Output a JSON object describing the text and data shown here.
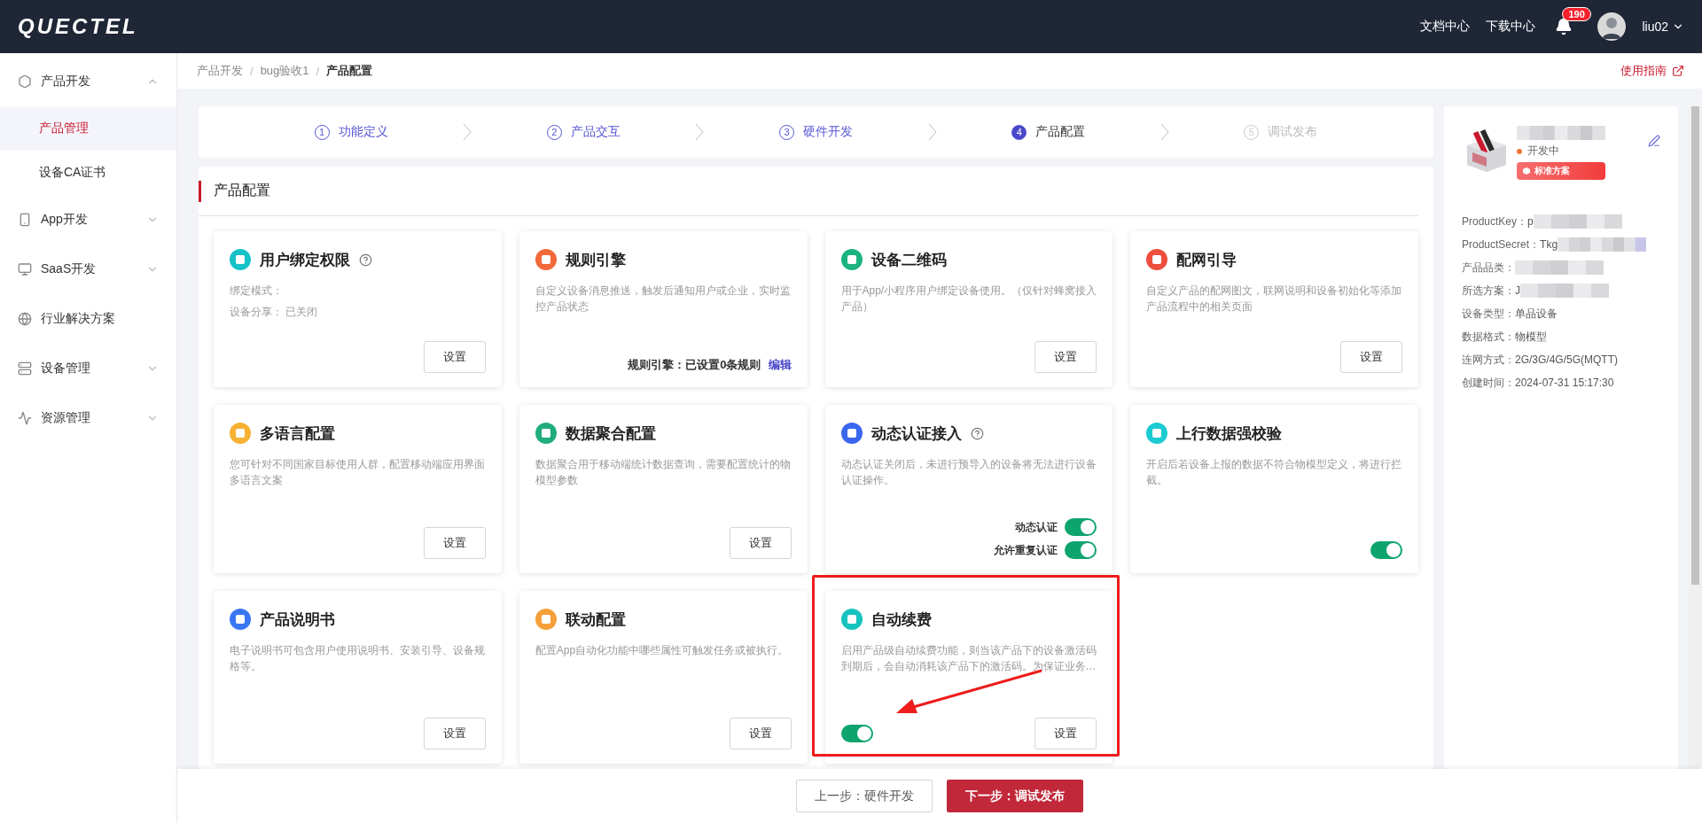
{
  "header": {
    "logo": "QUECTEL",
    "links": [
      "文档中心",
      "下载中心"
    ],
    "notifications": "190",
    "user": "liu02"
  },
  "sidebar": {
    "groups": [
      {
        "label": "产品开发",
        "expanded": true,
        "children": [
          {
            "label": "产品管理",
            "selected": true
          },
          {
            "label": "设备CA证书",
            "selected": false
          }
        ]
      },
      {
        "label": "App开发",
        "expanded": false
      },
      {
        "label": "SaaS开发",
        "expanded": false
      },
      {
        "label": "行业解决方案"
      },
      {
        "label": "设备管理",
        "expanded": false
      },
      {
        "label": "资源管理",
        "expanded": false
      }
    ]
  },
  "breadcrumb": [
    {
      "label": "产品开发"
    },
    {
      "separator": "/",
      "label": "bug验收1"
    },
    {
      "separator": "/",
      "label": "产品配置"
    }
  ],
  "guide_link": "使用指南",
  "steps": [
    {
      "number": "1",
      "label": "功能定义",
      "selected": false,
      "disabled": false
    },
    {
      "number": "2",
      "label": "产品交互",
      "selected": false,
      "disabled": false
    },
    {
      "number": "3",
      "label": "硬件开发",
      "selected": false,
      "disabled": false
    },
    {
      "number": "4",
      "label": "产品配置",
      "selected": true,
      "disabled": false
    },
    {
      "number": "5",
      "label": "调试发布",
      "selected": false,
      "disabled": true
    }
  ],
  "section_title": "产品配置",
  "cards": [
    {
      "title": "用户绑定权限",
      "help": true,
      "color": "#17c1c8",
      "highlighted": false,
      "description": [
        "绑定模式：",
        "设备分享： 已关闭"
      ],
      "footer": {
        "kind": "button",
        "label": "设置"
      }
    },
    {
      "title": "规则引擎",
      "help": false,
      "color": "#f2693a",
      "highlighted": false,
      "description": [
        "自定义设备消息推送，触发后通知用户或企业，实时监控产品状态"
      ],
      "footer": {
        "kind": "rule",
        "label": "规则引擎：",
        "value": "已设置0条规则",
        "link": "编辑"
      }
    },
    {
      "title": "设备二维码",
      "help": false,
      "color": "#1bb380",
      "highlighted": false,
      "description": [
        "用于App/小程序用户绑定设备使用。（仅针对蜂窝接入产品）"
      ],
      "footer": {
        "kind": "button",
        "label": "设置"
      }
    },
    {
      "title": "配网引导",
      "help": false,
      "color": "#ee4e3e",
      "highlighted": false,
      "description": [
        "自定义产品的配网图文，联网说明和设备初始化等添加产品流程中的相关页面"
      ],
      "footer": {
        "kind": "button",
        "label": "设置"
      }
    },
    {
      "title": "多语言配置",
      "help": false,
      "color": "#f7b234",
      "highlighted": false,
      "description": [
        "您可针对不同国家目标使用人群，配置移动端应用界面多语言文案"
      ],
      "footer": {
        "kind": "button",
        "label": "设置"
      }
    },
    {
      "title": "数据聚合配置",
      "help": false,
      "color": "#20ad7b",
      "highlighted": false,
      "description": [
        "数据聚合用于移动端统计数据查询，需要配置统计的物模型参数"
      ],
      "footer": {
        "kind": "button",
        "label": "设置"
      }
    },
    {
      "title": "动态认证接入",
      "help": true,
      "color": "#3a66ee",
      "highlighted": false,
      "description": [
        "动态认证关闭后，未进行预导入的设备将无法进行设备认证操作。"
      ],
      "footer": {
        "kind": "switches",
        "switches": [
          {
            "label": "动态认证",
            "on": true
          },
          {
            "label": "允许重复认证",
            "on": true
          }
        ]
      }
    },
    {
      "title": "上行数据强校验",
      "help": false,
      "color": "#1ccbd2",
      "highlighted": false,
      "description": [
        "开启后若设备上报的数据不符合物模型定义，将进行拦截。"
      ],
      "footer": {
        "kind": "switch",
        "on": true
      }
    },
    {
      "title": "产品说明书",
      "help": false,
      "color": "#3a76f4",
      "highlighted": false,
      "description": [
        "电子说明书可包含用户使用说明书、安装引导、设备规格等。"
      ],
      "footer": {
        "kind": "button",
        "label": "设置"
      }
    },
    {
      "title": "联动配置",
      "help": false,
      "color": "#f6a03a",
      "highlighted": false,
      "description": [
        "配置App自动化功能中哪些属性可触发任务或被执行。"
      ],
      "footer": {
        "kind": "button",
        "label": "设置"
      }
    },
    {
      "title": "自动续费",
      "help": false,
      "color": "#17c3bf",
      "highlighted": true,
      "description": [
        "启用产品级自动续费功能，则当该产品下的设备激活码到期后，会自动消耗该产品下的激活码。为保证业务…"
      ],
      "footer": {
        "kind": "switch_button",
        "on": true,
        "label": "设置"
      }
    }
  ],
  "product": {
    "status": "开发中",
    "plan": "标准方案",
    "info": [
      {
        "label": "ProductKey：",
        "value": "p",
        "blurred": true
      },
      {
        "label": "ProductSecret：",
        "value": "Tkg",
        "blurred": true
      },
      {
        "label": "产品品类：",
        "blurred": true
      },
      {
        "label": "所选方案：",
        "value": "J",
        "blurred": true
      },
      {
        "label": "设备类型：",
        "value": "单品设备",
        "blurred": false
      },
      {
        "label": "数据格式：",
        "value": "物模型",
        "blurred": false
      },
      {
        "label": "连网方式：",
        "value": "2G/3G/4G/5G(MQTT)",
        "blurred": false
      },
      {
        "label": "创建时间：",
        "value": "2024-07-31 15:17:30",
        "blurred": false
      }
    ]
  },
  "footer_buttons": [
    {
      "label": "上一步：硬件开发",
      "kind": "secondary"
    },
    {
      "label": "下一步：调试发布",
      "kind": "primary"
    }
  ]
}
